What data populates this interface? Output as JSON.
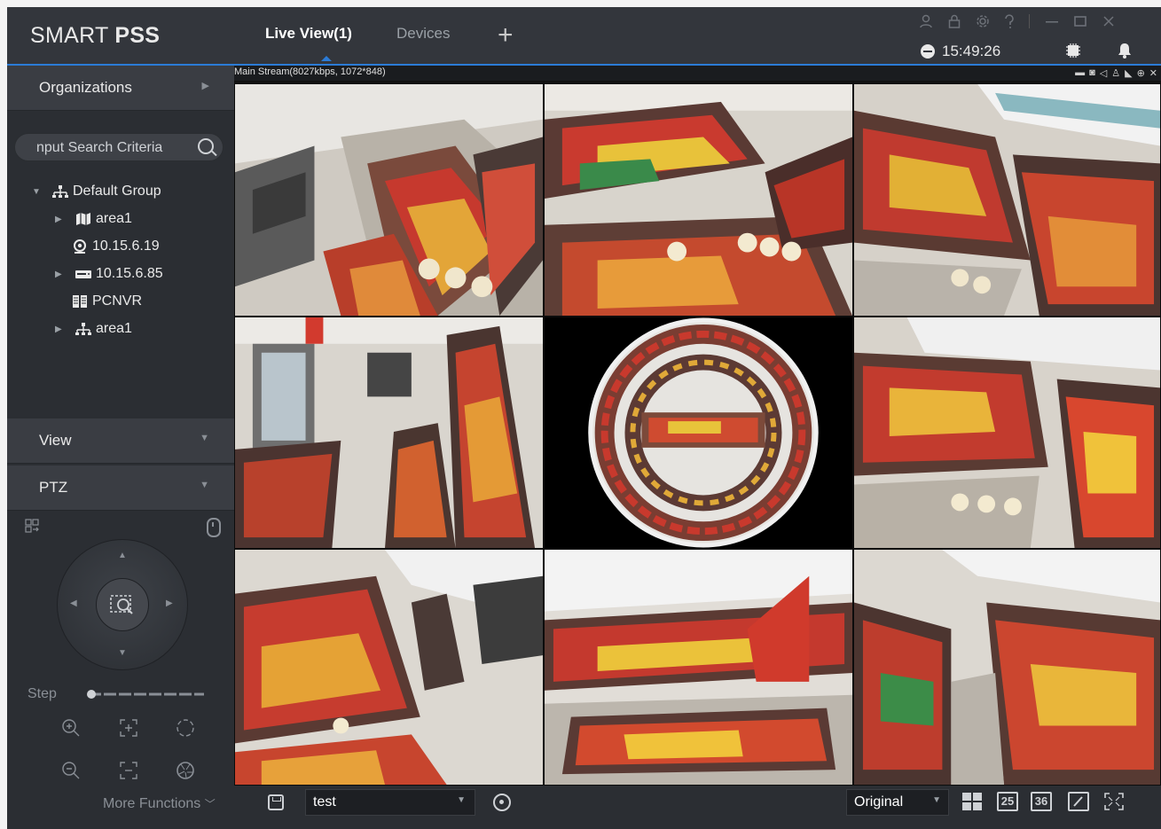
{
  "header": {
    "logo_light": "SMART",
    "logo_bold": "PSS",
    "tabs": [
      {
        "label": "Live View(1)",
        "active": true
      },
      {
        "label": "Devices",
        "active": false
      }
    ],
    "add_tab_label": "+",
    "time": "15:49:26",
    "window_icons": [
      "user-icon",
      "lock-icon",
      "settings-icon",
      "help-icon",
      "minimize-icon",
      "maximize-icon",
      "close-icon"
    ]
  },
  "sidebar": {
    "organizations_label": "Organizations",
    "search_placeholder": "nput Search Criteria",
    "tree": [
      {
        "label": "Default Group",
        "icon": "org-icon",
        "level": 0,
        "toggle": "expanded"
      },
      {
        "label": "area1",
        "icon": "map-icon",
        "level": 1,
        "toggle": "collapsed"
      },
      {
        "label": "10.15.6.19",
        "icon": "camera-icon",
        "level": 1,
        "toggle": "none"
      },
      {
        "label": "10.15.6.85",
        "icon": "nvr-icon",
        "level": 1,
        "toggle": "collapsed"
      },
      {
        "label": "PCNVR",
        "icon": "pcnvr-icon",
        "level": 1,
        "toggle": "none"
      },
      {
        "label": "area1",
        "icon": "org-icon",
        "level": 1,
        "toggle": "collapsed"
      }
    ],
    "view_label": "View",
    "ptz_label": "PTZ",
    "step_label": "Step",
    "step_value": 0.0,
    "more_functions_label": "More Functions"
  },
  "video": {
    "stream_info": "Main Stream(8027kbps, 1072*848)",
    "stream_icons": [
      "record-icon",
      "snapshot-icon",
      "audio-icon",
      "talk-icon",
      "ivs-icon",
      "zoom-icon",
      "close-icon"
    ],
    "cells": 9
  },
  "bottom_bar": {
    "view_name": "test",
    "stream_mode": "Original",
    "layout_25_label": "25",
    "layout_36_label": "36"
  },
  "colors": {
    "accent": "#2b7bd6",
    "panel": "#2b2e33",
    "header": "#33363c",
    "section": "#3a3d43"
  }
}
